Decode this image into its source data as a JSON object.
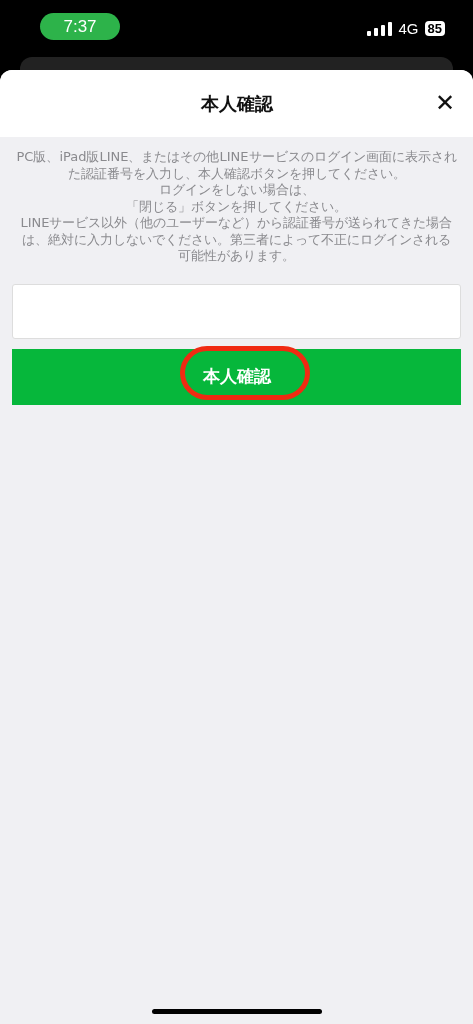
{
  "status_bar": {
    "time": "7:37",
    "network": "4G",
    "battery": "85"
  },
  "dialog": {
    "title": "本人確認",
    "close": "✕"
  },
  "instructions": [
    "PC版、iPad版LINE、またはその他LINEサービスのログイン画面に表示された認証番号を入力し、本人確認ボタンを押してください。",
    "ログインをしない場合は、",
    "「閉じる」ボタンを押してください。",
    "LINEサービス以外（他のユーザーなど）から認証番号が送られてきた場合は、絶対に入力しないでください。第三者によって不正にログインされる可能性があります。"
  ],
  "confirm_button": {
    "label": "本人確認",
    "highlighted": true
  }
}
